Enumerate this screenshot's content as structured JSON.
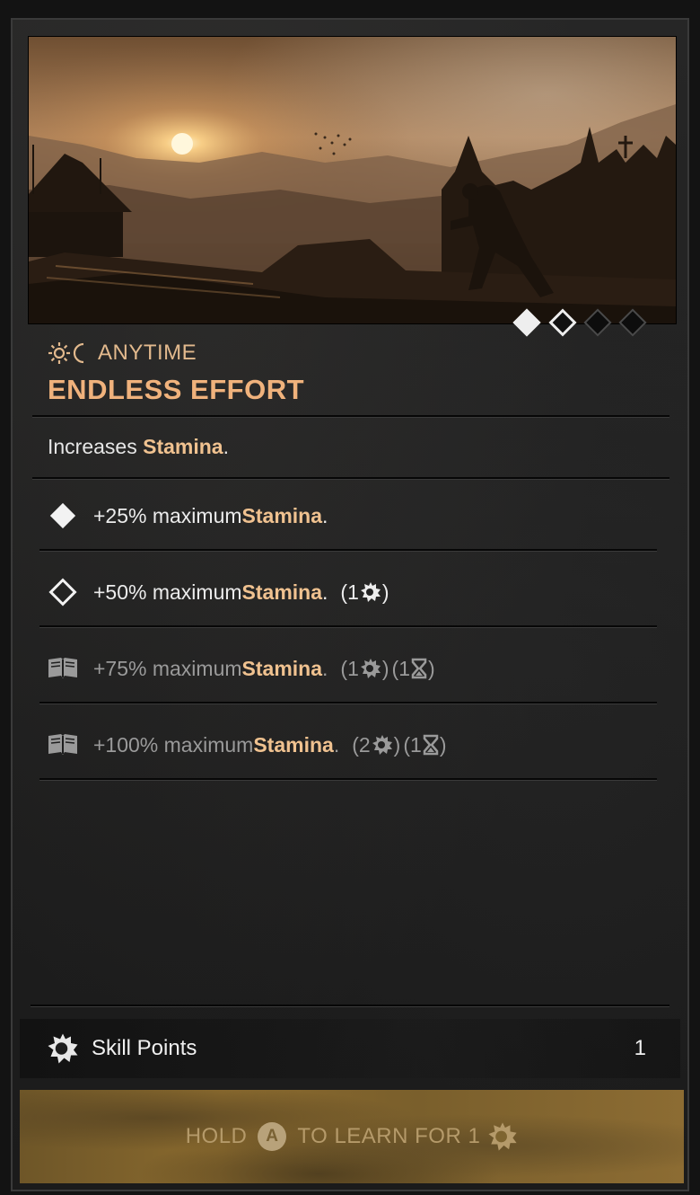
{
  "tiers": [
    "learned",
    "next",
    "locked",
    "locked"
  ],
  "time_of_day": "ANYTIME",
  "title": "ENDLESS EFFORT",
  "description": {
    "prefix": "Increases ",
    "highlight": "Stamina",
    "suffix": "."
  },
  "ranks": [
    {
      "icon": "filled-diamond-icon",
      "pre": "+25% maximum ",
      "stat": "Stamina",
      "post": ".",
      "cost_sp": "",
      "cost_time": "",
      "state": "learned"
    },
    {
      "icon": "outline-diamond-icon",
      "pre": "+50% maximum ",
      "stat": "Stamina",
      "post": ".",
      "cost_sp": "1",
      "cost_time": "",
      "state": "available"
    },
    {
      "icon": "book-icon",
      "pre": "+75% maximum ",
      "stat": "Stamina",
      "post": ".",
      "cost_sp": "1",
      "cost_time": "1",
      "state": "locked"
    },
    {
      "icon": "book-icon",
      "pre": "+100% maximum ",
      "stat": "Stamina",
      "post": ".",
      "cost_sp": "2",
      "cost_time": "1",
      "state": "locked"
    }
  ],
  "skill_points": {
    "label": "Skill Points",
    "value": "1"
  },
  "learn_button": {
    "hold": "HOLD",
    "key": "A",
    "action": "TO LEARN FOR 1"
  },
  "colors": {
    "accent": "#f0b27c",
    "highlight": "#f0c290",
    "text": "#ececec",
    "dim_text": "#9a9a9a"
  }
}
